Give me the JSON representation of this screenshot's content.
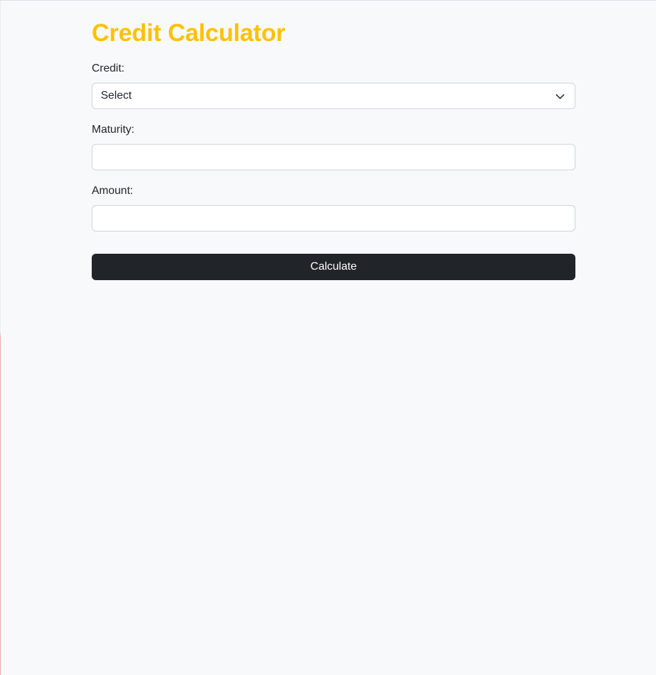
{
  "page": {
    "title": "Credit Calculator",
    "title_color": "#ffc107"
  },
  "form": {
    "credit": {
      "label": "Credit:",
      "selected": "Select",
      "icon": "chevron-down-icon"
    },
    "maturity": {
      "label": "Maturity:",
      "value": "",
      "placeholder": ""
    },
    "amount": {
      "label": "Amount:",
      "value": "",
      "placeholder": ""
    },
    "submit_label": "Calculate",
    "submit_color": "#212529"
  }
}
